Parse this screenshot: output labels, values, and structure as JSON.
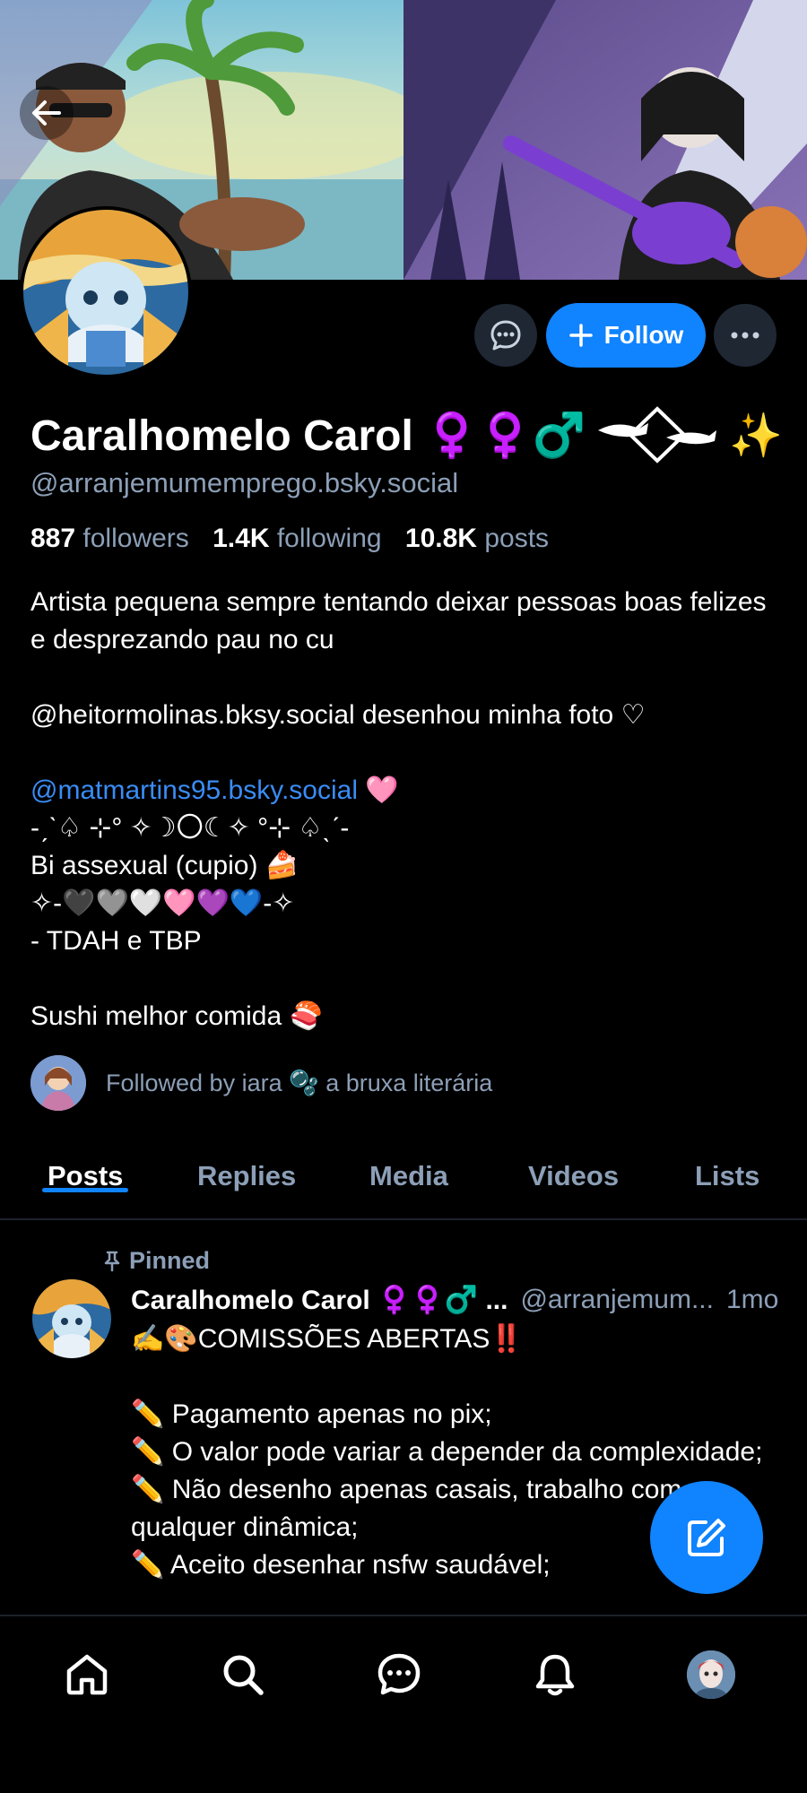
{
  "profile": {
    "display_name": "Caralhomelo Carol ♀️♀️♂️",
    "name_emoji": "✨",
    "handle": "@arranjemumemprego.bsky.social",
    "followers_count": "887",
    "followers_label": "followers",
    "following_count": "1.4K",
    "following_label": "following",
    "posts_count": "10.8K",
    "posts_label": "posts"
  },
  "actions": {
    "follow_label": "Follow"
  },
  "bio": {
    "line1": "Artista pequena sempre tentando deixar pessoas boas felizes e desprezando pau no cu",
    "line2": "@heitormolinas.bksy.social desenhou minha foto ♡",
    "mention": "@matmartins95.bsky.social",
    "mention_emoji": "🩷",
    "line3": "-ˏˋ♤ ⊹° ✧☽〇☾✧ °⊹ ♤ˎˊ-",
    "line4": "Bi assexual (cupio) 🍰",
    "line5": "✧-🖤🩶🤍🩷💜💙-✧",
    "line6": "- TDAH e TBP",
    "line7": "Sushi melhor comida 🍣"
  },
  "followed_by": {
    "text": "Followed by iara 🫧 a bruxa literária"
  },
  "tabs": [
    {
      "label": "Posts"
    },
    {
      "label": "Replies"
    },
    {
      "label": "Media"
    },
    {
      "label": "Videos"
    },
    {
      "label": "Lists"
    }
  ],
  "post": {
    "pinned_label": "Pinned",
    "author": "Caralhomelo Carol ♀️♀️♂️ ...",
    "handle": "@arranjemum...",
    "time": "1mo",
    "lines": [
      "✍️🎨COMISSÕES ABERTAS‼️",
      "",
      "✏️ Pagamento apenas no pix;",
      "✏️ O valor pode variar a depender da complexidade;",
      "✏️ Não desenho apenas casais, trabalho com qualquer dinâmica;",
      "✏️ Aceito desenhar nsfw saudável;"
    ]
  },
  "colors": {
    "accent": "#1083fe",
    "muted": "#8c9fb7",
    "mention": "#3a8cf5",
    "background": "#000000",
    "button_dark": "#1f2733"
  },
  "icons": {
    "back": "arrow-left-icon",
    "message": "chat-bubble-icon",
    "follow": "plus-icon",
    "more": "ellipsis-icon",
    "pin": "pin-icon",
    "compose": "compose-icon",
    "home": "home-icon",
    "search": "search-icon",
    "chat": "chat-icon",
    "notifications": "bell-icon"
  }
}
